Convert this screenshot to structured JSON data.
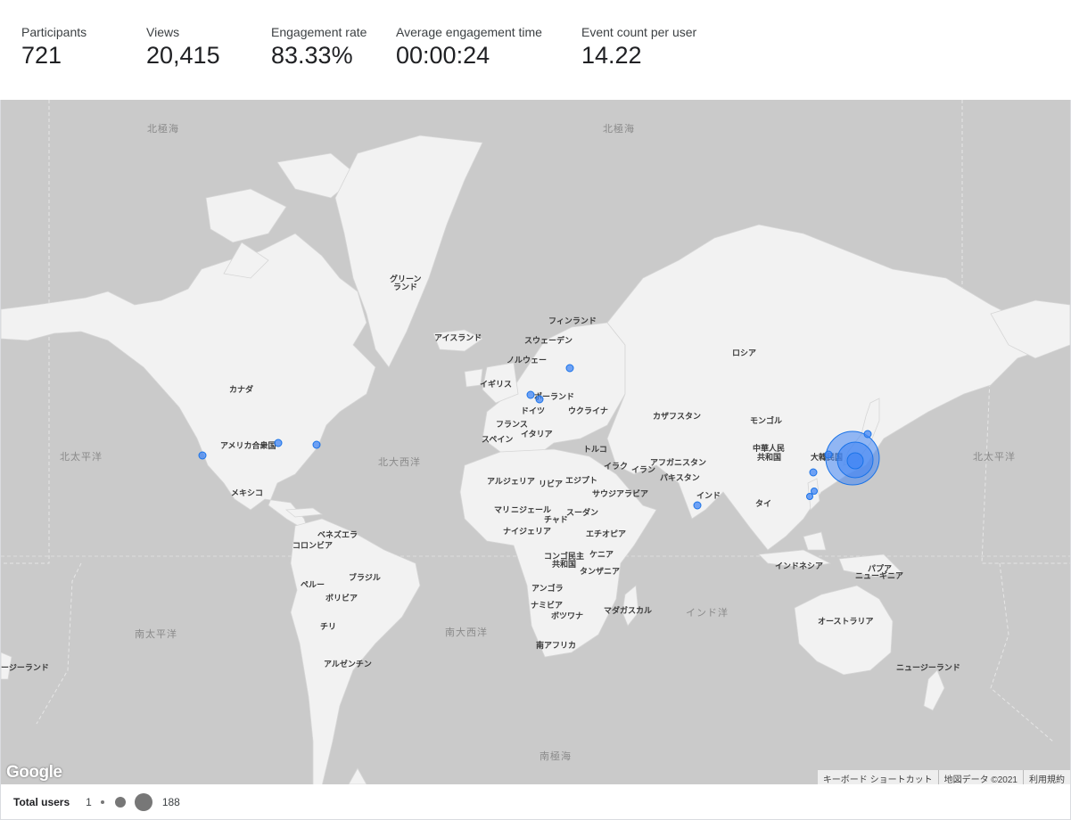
{
  "metrics": [
    {
      "label": "Participants",
      "value": "721"
    },
    {
      "label": "Views",
      "value": "20,415"
    },
    {
      "label": "Engagement rate",
      "value": "83.33%"
    },
    {
      "label": "Average engagement time",
      "value": "00:00:24"
    },
    {
      "label": "Event count per user",
      "value": "14.22"
    }
  ],
  "map": {
    "oceans": {
      "arctic_left": "北極海",
      "arctic_right": "北極海",
      "north_pacific_left": "北太平洋",
      "north_pacific_right": "北太平洋",
      "north_atlantic": "北大西洋",
      "south_atlantic": "南大西洋",
      "south_pacific": "南太平洋",
      "indian_ocean": "インド洋",
      "southern_ocean": "南極海"
    },
    "countries": {
      "greenland_1": "グリーン",
      "greenland_2": "ランド",
      "iceland": "アイスランド",
      "finland": "フィンランド",
      "sweden": "スウェーデン",
      "norway": "ノルウェー",
      "uk": "イギリス",
      "poland": "ポーランド",
      "germany": "ドイツ",
      "ukraine": "ウクライナ",
      "france": "フランス",
      "italy": "イタリア",
      "spain": "スペイン",
      "turkey": "トルコ",
      "russia": "ロシア",
      "kazakhstan": "カザフスタン",
      "mongolia": "モンゴル",
      "china_1": "中華人民",
      "china_2": "共和国",
      "iraq": "イラク",
      "iran": "イラン",
      "afghanistan": "アフガニスタン",
      "pakistan": "パキスタン",
      "india": "インド",
      "thailand": "タイ",
      "saudi": "サウジアラビア",
      "egypt": "エジプト",
      "libya": "リビア",
      "algeria": "アルジェリア",
      "mali": "マリ",
      "niger": "ニジェール",
      "chad": "チャド",
      "sudan": "スーダン",
      "nigeria": "ナイジェリア",
      "ethiopia": "エチオピア",
      "drc_1": "コンゴ民主",
      "drc_2": "共和国",
      "kenya": "ケニア",
      "tanzania": "タンザニア",
      "angola": "アンゴラ",
      "namibia": "ナミビア",
      "botswana": "ボツワナ",
      "madagascar": "マダガスカル",
      "south_africa": "南アフリカ",
      "canada": "カナダ",
      "usa": "アメリカ合衆国",
      "mexico": "メキシコ",
      "venezuela": "ベネズエラ",
      "colombia": "コロンビア",
      "brazil": "ブラジル",
      "peru": "ペルー",
      "bolivia": "ボリビア",
      "chile": "チリ",
      "argentina": "アルゼンチン",
      "indonesia": "インドネシア",
      "png_1": "パプア",
      "png_2": "ニューギニア",
      "australia": "オーストラリア",
      "new_zealand_left": "ージーランド",
      "new_zealand_right": "ニュージーランド",
      "korea": "大韓民国"
    },
    "google_logo": "Google",
    "attribution": {
      "shortcuts": "キーボード ショートカット",
      "map_data": "地図データ ©2021",
      "terms": "利用規約"
    }
  },
  "legend": {
    "title": "Total users",
    "min": "1",
    "max": "188"
  },
  "colors": {
    "bubble_fill": "#4285f4",
    "bubble_stroke": "#1a73e8",
    "land": "#f2f2f2",
    "water": "#cacaca"
  }
}
